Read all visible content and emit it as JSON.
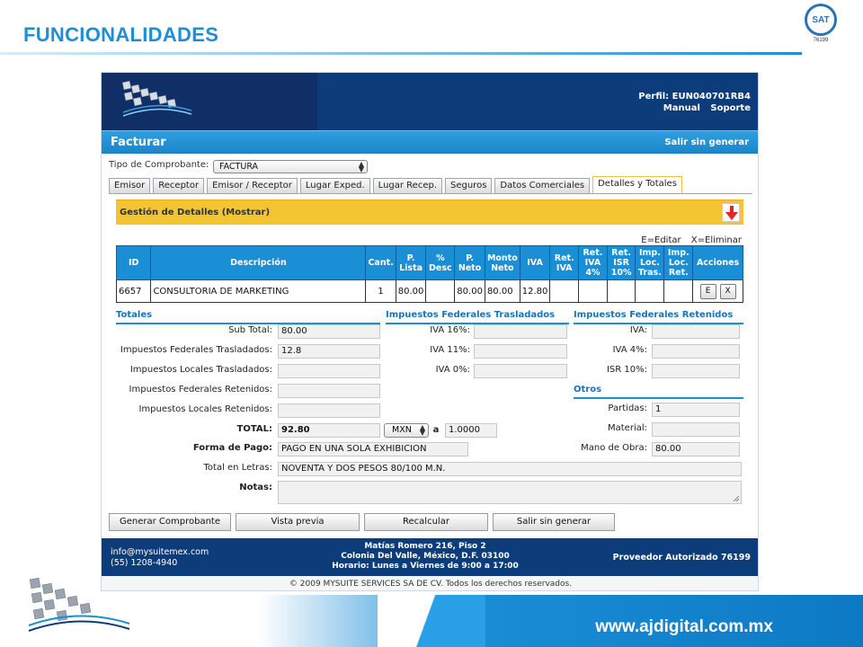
{
  "slide": {
    "title": "FUNCIONALIDADES",
    "website": "www.ajdigital.com.mx",
    "sat_logo_text": "SAT",
    "sat_number": "76199"
  },
  "app": {
    "profile_line": "Perfil: EUN040701RB4",
    "links": [
      "Manual",
      "Soporte"
    ],
    "page_title": "Facturar",
    "exit_link": "Salir sin generar",
    "tipo_label": "Tipo de Comprobante:",
    "tipo_value": "FACTURA",
    "tabs": [
      "Emisor",
      "Receptor",
      "Emisor / Receptor",
      "Lugar Exped.",
      "Lugar Recep.",
      "Seguros",
      "Datos Comerciales",
      "Detalles y Totales"
    ],
    "active_tab": "Detalles y Totales",
    "panel_title": "Gestión de Detalles (Mostrar)",
    "legend": [
      "E=Editar",
      "X=Eliminar"
    ],
    "table": {
      "headers": [
        "ID",
        "Descripción",
        "Cant.",
        "P. Lista",
        "% Desc",
        "P. Neto",
        "Monto Neto",
        "IVA",
        "Ret. IVA",
        "Ret. IVA 4%",
        "Ret. ISR 10%",
        "Imp. Loc. Tras.",
        "Imp. Loc. Ret.",
        "Acciones"
      ],
      "rows": [
        {
          "id": "6657",
          "descripcion": "CONSULTORIA DE MARKETING",
          "cant": "1",
          "p_lista": "80.00",
          "desc": "",
          "p_neto": "80.00",
          "monto_neto": "80.00",
          "iva": "12.80",
          "ret_iva": "",
          "ret_iva4": "",
          "ret_isr10": "",
          "imp_loc_tras": "",
          "imp_loc_ret": "",
          "edit": "E",
          "delete": "X"
        }
      ]
    },
    "totales": {
      "heading": "Totales",
      "sub_total_label": "Sub Total:",
      "sub_total": "80.00",
      "imp_fed_tras_label": "Impuestos Federales Trasladados:",
      "imp_fed_tras": "12.8",
      "imp_loc_tras_label": "Impuestos Locales Trasladados:",
      "imp_loc_tras": "",
      "imp_fed_ret_label": "Impuestos Federales Retenidos:",
      "imp_fed_ret": "",
      "imp_loc_ret_label": "Impuestos Locales Retenidos:",
      "imp_loc_ret": "",
      "total_label": "TOTAL:",
      "total": "92.80",
      "currency": "MXN",
      "rate_sep": "a",
      "rate": "1.0000",
      "forma_pago_label": "Forma de Pago:",
      "forma_pago": "PAGO EN UNA SOLA EXHIBICION",
      "total_letras_label": "Total en Letras:",
      "total_letras": "NOVENTA Y DOS PESOS 80/100 M.N.",
      "notas_label": "Notas:"
    },
    "trasladados": {
      "heading": "Impuestos Federales Trasladados",
      "iva16_label": "IVA 16%:",
      "iva11_label": "IVA 11%:",
      "iva0_label": "IVA 0%:"
    },
    "retenidos": {
      "heading": "Impuestos Federales Retenidos",
      "iva_label": "IVA:",
      "iva4_label": "IVA 4%:",
      "isr10_label": "ISR 10%:"
    },
    "otros": {
      "heading": "Otros",
      "partidas_label": "Partidas:",
      "partidas": "1",
      "material_label": "Material:",
      "material": "",
      "mano_obra_label": "Mano de Obra:",
      "mano_obra": "80.00"
    },
    "buttons": [
      "Generar Comprobante",
      "Vista previa",
      "Recalcular",
      "Salir sin generar"
    ],
    "footer": {
      "email": "info@mysuitemex.com",
      "phone": "(55) 1208-4940",
      "address1": "Matías Romero 216, Piso 2",
      "address2": "Colonia Del Valle, México, D.F. 03100",
      "hours": "Horario: Lunes a Viernes de 9:00 a 17:00",
      "provider": "Proveedor Autorizado 76199",
      "copyright": "© 2009 MYSUITE SERVICES SA DE CV. Todos los derechos reservados."
    }
  },
  "colors": {
    "accent_blue": "#1a8fd6",
    "header_navy": "#0d3c7a",
    "panel_yellow": "#f4c533"
  }
}
